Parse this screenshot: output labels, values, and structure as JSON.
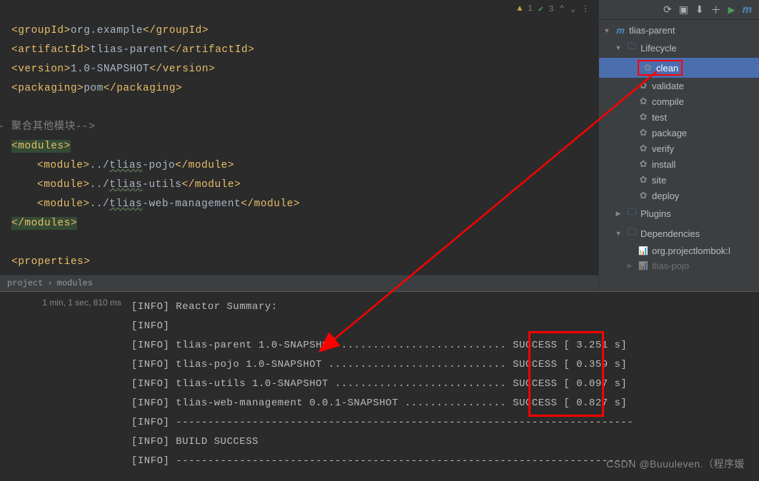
{
  "editor_bar": {
    "warn_count": "1",
    "check_count": "3"
  },
  "code": {
    "groupId_open": "<groupId>",
    "groupId_text": "org.example",
    "groupId_close": "</groupId>",
    "artifactId_open": "<artifactId>",
    "artifactId_text": "tlias-parent",
    "artifactId_close": "</artifactId>",
    "version_open": "<version>",
    "version_text": "1.0-SNAPSHOT",
    "version_close": "</version>",
    "packaging_open": "<packaging>",
    "packaging_text": "pom",
    "packaging_close": "</packaging>",
    "comment_prefix": "--     ",
    "comment_text": "聚合其他模块-->",
    "modules_open": "<modules>",
    "module_open": "<module>",
    "module_close": "</module>",
    "m1_prefix": "../",
    "m1_name": "tlias",
    "m1_suffix": "-pojo",
    "m2_prefix": "../",
    "m2_name": "tlias",
    "m2_suffix": "-utils",
    "m3_prefix": "../",
    "m3_name": "tlias",
    "m3_suffix": "-web-management",
    "modules_close": "</modules>",
    "properties_open": "<properties>"
  },
  "breadcrumb": {
    "item1": "project",
    "item2": "modules"
  },
  "maven_panel": {
    "root": "tlias-parent",
    "lifecycle": "Lifecycle",
    "goals": {
      "clean": "clean",
      "validate": "validate",
      "compile": "compile",
      "test": "test",
      "package": "package",
      "verify": "verify",
      "install": "install",
      "site": "site",
      "deploy": "deploy"
    },
    "plugins": "Plugins",
    "dependencies": "Dependencies",
    "dep1": "org.projectlombok:l",
    "dep2": "tlias-pojo"
  },
  "console": {
    "timer": "1 min, 1 sec, 810 ms",
    "lines": {
      "l1": "[INFO] Reactor Summary:",
      "l2": "[INFO]",
      "l3p": "[INFO] tlias-parent 1.0-SNAPSHOT ..........................",
      "l3s": " SUCCESS ",
      "l3t": "[  3.251 s]",
      "l4p": "[INFO] tlias-pojo 1.0-SNAPSHOT ............................",
      "l4s": " SUCCESS ",
      "l4t": "[  0.359 s]",
      "l5p": "[INFO] tlias-utils 1.0-SNAPSHOT ...........................",
      "l5s": " SUCCESS ",
      "l5t": "[  0.097 s]",
      "l6p": "[INFO] tlias-web-management 0.0.1-SNAPSHOT ................",
      "l6s": " SUCCESS ",
      "l6t": "[  0.827 s]",
      "l7": "[INFO] ------------------------------------------------------------------------",
      "l8": "[INFO] BUILD SUCCESS",
      "l9": "[INFO] ------------------------------------------------------------------------"
    }
  },
  "watermark": "CSDN @Buuuleven.（程序媛"
}
